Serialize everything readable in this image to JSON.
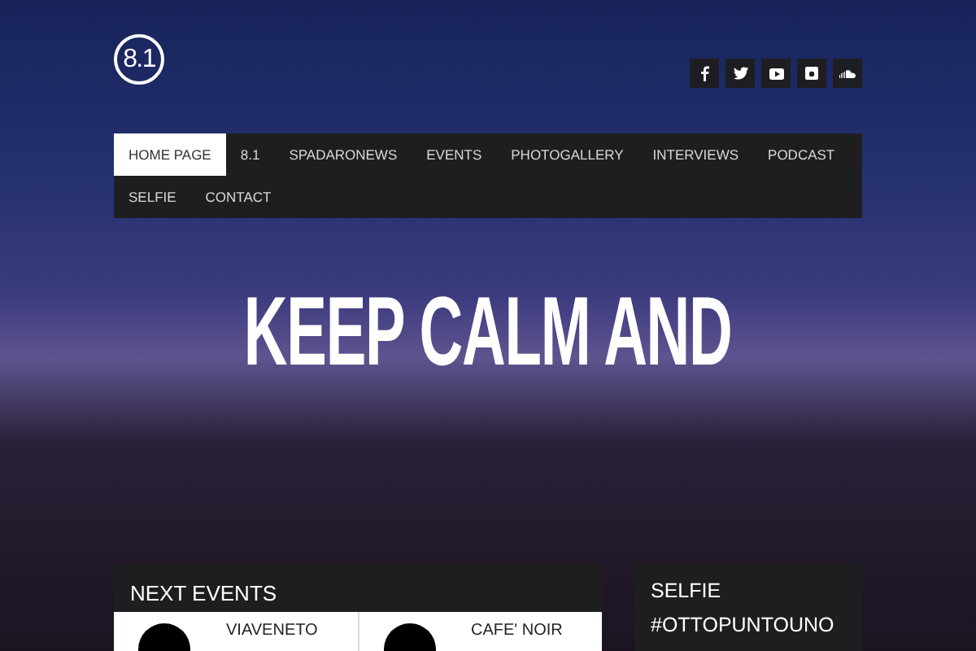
{
  "logo": {
    "text": "8.1"
  },
  "nav": [
    {
      "label": "HOME PAGE",
      "selected": true
    },
    {
      "label": "8.1",
      "selected": false
    },
    {
      "label": "SPADARONEWS",
      "selected": false
    },
    {
      "label": "EVENTS",
      "selected": false
    },
    {
      "label": "PHOTOGALLERY",
      "selected": false
    },
    {
      "label": "INTERVIEWS",
      "selected": false
    },
    {
      "label": "PODCAST",
      "selected": false
    },
    {
      "label": "SELFIE",
      "selected": false
    },
    {
      "label": "CONTACT",
      "selected": false
    }
  ],
  "headline": "KEEP CALM AND",
  "next_events": {
    "title": "NEXT EVENTS",
    "events": [
      {
        "name": "VIAVENETO"
      },
      {
        "name": "CAFE' NOIR"
      }
    ]
  },
  "selfie": {
    "title": "SELFIE #OTTOPUNTOUNO"
  }
}
